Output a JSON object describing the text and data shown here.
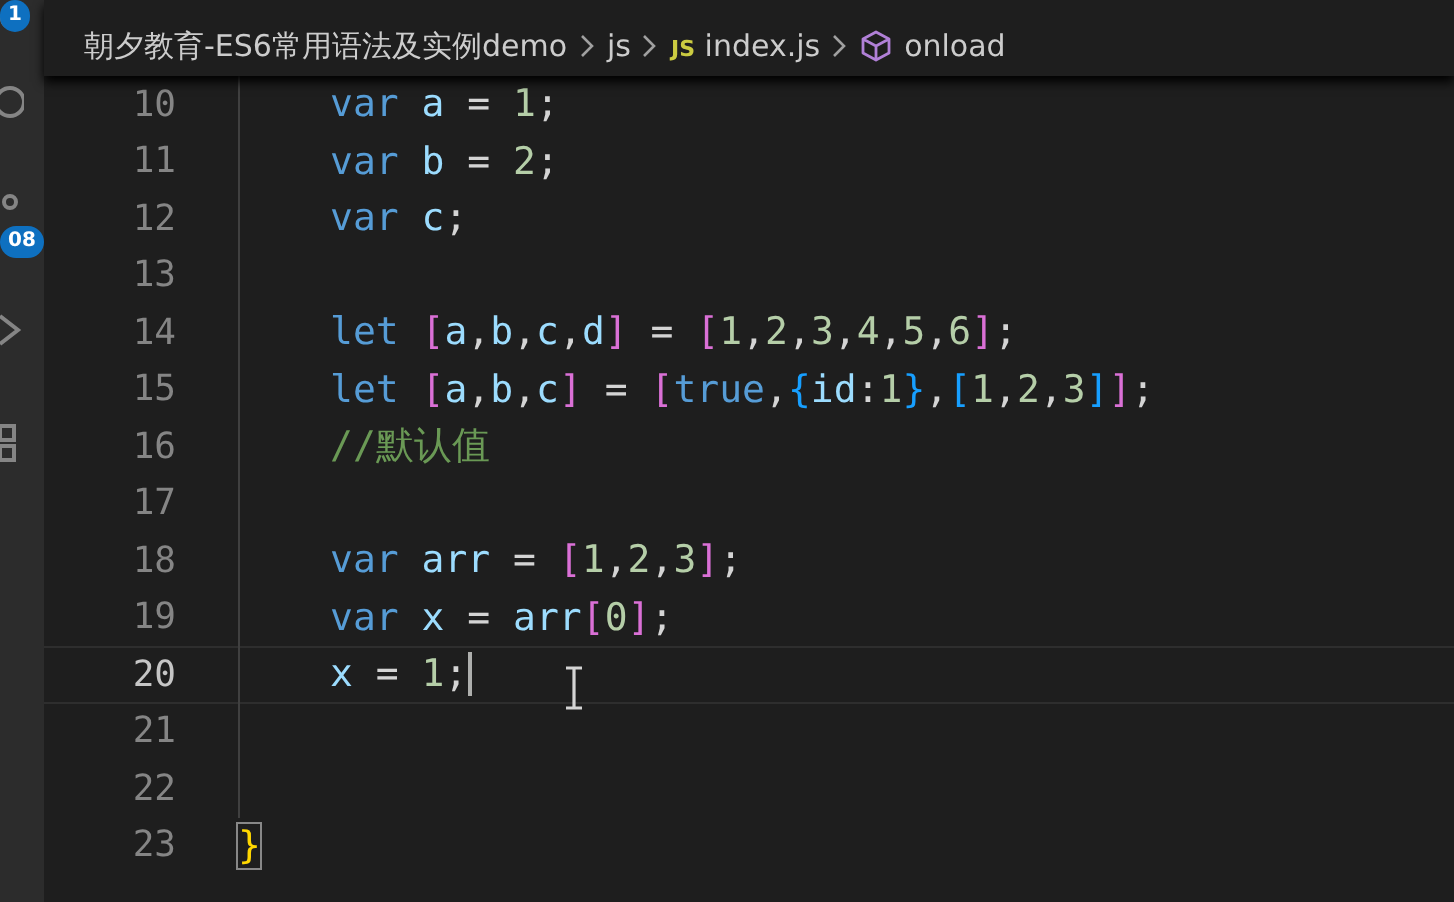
{
  "activity_bar": {
    "items": [
      {
        "kind": "account",
        "badge": "1"
      },
      {
        "kind": "search"
      },
      {
        "kind": "source-control",
        "badge": "08"
      },
      {
        "kind": "run"
      },
      {
        "kind": "extensions"
      }
    ]
  },
  "breadcrumb": {
    "items": [
      {
        "kind": "folder",
        "text": "朝夕教育-ES6常用语法及实例demo"
      },
      {
        "kind": "folder",
        "text": "js"
      },
      {
        "kind": "js-file",
        "badge": "JS",
        "text": "index.js"
      },
      {
        "kind": "symbol",
        "text": "onload"
      }
    ]
  },
  "editor": {
    "lines": [
      {
        "number": "10",
        "current": false,
        "indented": true,
        "tokens": [
          {
            "kind": "keyword",
            "text": "var"
          },
          {
            "kind": "variable",
            "text": " a"
          },
          {
            "kind": "plain",
            "text": " = "
          },
          {
            "kind": "number",
            "text": "1"
          },
          {
            "kind": "plain",
            "text": ";"
          }
        ]
      },
      {
        "number": "11",
        "current": false,
        "indented": true,
        "tokens": [
          {
            "kind": "keyword",
            "text": "var"
          },
          {
            "kind": "variable",
            "text": " b"
          },
          {
            "kind": "plain",
            "text": " = "
          },
          {
            "kind": "number",
            "text": "2"
          },
          {
            "kind": "plain",
            "text": ";"
          }
        ]
      },
      {
        "number": "12",
        "current": false,
        "indented": true,
        "tokens": [
          {
            "kind": "keyword",
            "text": "var"
          },
          {
            "kind": "variable",
            "text": " c"
          },
          {
            "kind": "plain",
            "text": ";"
          }
        ]
      },
      {
        "number": "13",
        "current": false,
        "indented": true
      },
      {
        "number": "14",
        "current": false,
        "indented": true,
        "tokens": [
          {
            "kind": "keyword",
            "text": "let"
          },
          {
            "kind": "bracket",
            "text": " ["
          },
          {
            "kind": "variable",
            "text": "a"
          },
          {
            "kind": "plain",
            "text": ","
          },
          {
            "kind": "variable",
            "text": "b"
          },
          {
            "kind": "plain",
            "text": ","
          },
          {
            "kind": "variable",
            "text": "c"
          },
          {
            "kind": "plain",
            "text": ","
          },
          {
            "kind": "variable",
            "text": "d"
          },
          {
            "kind": "bracket",
            "text": "]"
          },
          {
            "kind": "plain",
            "text": " = "
          },
          {
            "kind": "bracket",
            "text": "["
          },
          {
            "kind": "number",
            "text": "1"
          },
          {
            "kind": "plain",
            "text": ","
          },
          {
            "kind": "number",
            "text": "2"
          },
          {
            "kind": "plain",
            "text": ","
          },
          {
            "kind": "number",
            "text": "3"
          },
          {
            "kind": "plain",
            "text": ","
          },
          {
            "kind": "number",
            "text": "4"
          },
          {
            "kind": "plain",
            "text": ","
          },
          {
            "kind": "number",
            "text": "5"
          },
          {
            "kind": "plain",
            "text": ","
          },
          {
            "kind": "number",
            "text": "6"
          },
          {
            "kind": "bracket",
            "text": "]"
          },
          {
            "kind": "plain",
            "text": ";"
          }
        ]
      },
      {
        "number": "15",
        "current": false,
        "indented": true,
        "tokens": [
          {
            "kind": "keyword",
            "text": "let"
          },
          {
            "kind": "bracket",
            "text": " ["
          },
          {
            "kind": "variable",
            "text": "a"
          },
          {
            "kind": "plain",
            "text": ","
          },
          {
            "kind": "variable",
            "text": "b"
          },
          {
            "kind": "plain",
            "text": ","
          },
          {
            "kind": "variable",
            "text": "c"
          },
          {
            "kind": "bracket",
            "text": "]"
          },
          {
            "kind": "plain",
            "text": " = "
          },
          {
            "kind": "bracket",
            "text": "["
          },
          {
            "kind": "keyword",
            "text": "true"
          },
          {
            "kind": "plain",
            "text": ","
          },
          {
            "kind": "bracket2",
            "text": "{"
          },
          {
            "kind": "variable",
            "text": "id"
          },
          {
            "kind": "plain",
            "text": ":"
          },
          {
            "kind": "number",
            "text": "1"
          },
          {
            "kind": "bracket2",
            "text": "}"
          },
          {
            "kind": "plain",
            "text": ","
          },
          {
            "kind": "bracket2",
            "text": "["
          },
          {
            "kind": "number",
            "text": "1"
          },
          {
            "kind": "plain",
            "text": ","
          },
          {
            "kind": "number",
            "text": "2"
          },
          {
            "kind": "plain",
            "text": ","
          },
          {
            "kind": "number",
            "text": "3"
          },
          {
            "kind": "bracket2",
            "text": "]"
          },
          {
            "kind": "bracket",
            "text": "]"
          },
          {
            "kind": "plain",
            "text": ";"
          }
        ]
      },
      {
        "number": "16",
        "current": false,
        "indented": true,
        "tokens": [
          {
            "kind": "comment",
            "text": "//默认值"
          }
        ]
      },
      {
        "number": "17",
        "current": false,
        "indented": true
      },
      {
        "number": "18",
        "current": false,
        "indented": true,
        "tokens": [
          {
            "kind": "keyword",
            "text": "var"
          },
          {
            "kind": "variable",
            "text": " arr"
          },
          {
            "kind": "plain",
            "text": " = "
          },
          {
            "kind": "bracket",
            "text": "["
          },
          {
            "kind": "number",
            "text": "1"
          },
          {
            "kind": "plain",
            "text": ","
          },
          {
            "kind": "number",
            "text": "2"
          },
          {
            "kind": "plain",
            "text": ","
          },
          {
            "kind": "number",
            "text": "3"
          },
          {
            "kind": "bracket",
            "text": "]"
          },
          {
            "kind": "plain",
            "text": ";"
          }
        ]
      },
      {
        "number": "19",
        "current": false,
        "indented": true,
        "tokens": [
          {
            "kind": "keyword",
            "text": "var"
          },
          {
            "kind": "variable",
            "text": " x"
          },
          {
            "kind": "plain",
            "text": " = "
          },
          {
            "kind": "variable",
            "text": "arr"
          },
          {
            "kind": "bracket",
            "text": "["
          },
          {
            "kind": "number",
            "text": "0"
          },
          {
            "kind": "bracket",
            "text": "]"
          },
          {
            "kind": "plain",
            "text": ";"
          }
        ]
      },
      {
        "number": "20",
        "current": true,
        "indented": true,
        "tokens": [
          {
            "kind": "variable",
            "text": "x"
          },
          {
            "kind": "plain",
            "text": " = "
          },
          {
            "kind": "number",
            "text": "1"
          },
          {
            "kind": "plain",
            "text": ";"
          }
        ]
      },
      {
        "number": "21",
        "current": false,
        "indented": true
      },
      {
        "number": "22",
        "current": false,
        "indented": true
      },
      {
        "number": "23",
        "current": false,
        "indented": false,
        "tokens": [
          {
            "kind": "matched-brace",
            "text": "}"
          }
        ]
      }
    ]
  }
}
